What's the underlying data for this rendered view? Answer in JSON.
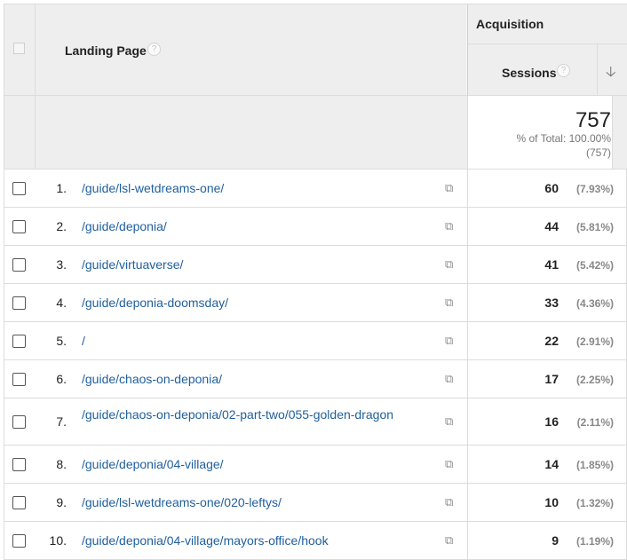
{
  "header": {
    "landing_page_label": "Landing Page",
    "acquisition_label": "Acquisition",
    "sessions_label": "Sessions",
    "help_glyph": "?",
    "sort_glyph": "🡣"
  },
  "totals": {
    "sessions": "757",
    "percent_label": "% of Total: 100.00%",
    "absolute": "(757)"
  },
  "rows": [
    {
      "index": "1.",
      "page": "/guide/lsl-wetdreams-one/",
      "sessions": "60",
      "share": "(7.93%)"
    },
    {
      "index": "2.",
      "page": "/guide/deponia/",
      "sessions": "44",
      "share": "(5.81%)"
    },
    {
      "index": "3.",
      "page": "/guide/virtuaverse/",
      "sessions": "41",
      "share": "(5.42%)"
    },
    {
      "index": "4.",
      "page": "/guide/deponia-doomsday/",
      "sessions": "33",
      "share": "(4.36%)"
    },
    {
      "index": "5.",
      "page": "/",
      "sessions": "22",
      "share": "(2.91%)"
    },
    {
      "index": "6.",
      "page": "/guide/chaos-on-deponia/",
      "sessions": "17",
      "share": "(2.25%)"
    },
    {
      "index": "7.",
      "page": "/guide/chaos-on-deponia/02-part-two/055-golden-dragon",
      "sessions": "16",
      "share": "(2.11%)"
    },
    {
      "index": "8.",
      "page": "/guide/deponia/04-village/",
      "sessions": "14",
      "share": "(1.85%)"
    },
    {
      "index": "9.",
      "page": "/guide/lsl-wetdreams-one/020-leftys/",
      "sessions": "10",
      "share": "(1.32%)"
    },
    {
      "index": "10.",
      "page": "/guide/deponia/04-village/mayors-office/hook",
      "sessions": "9",
      "share": "(1.19%)"
    }
  ],
  "icons": {
    "external_link": "open-in-new-window-icon"
  },
  "colors": {
    "link": "#1f5f9e",
    "header_bg": "#eeeeee"
  }
}
